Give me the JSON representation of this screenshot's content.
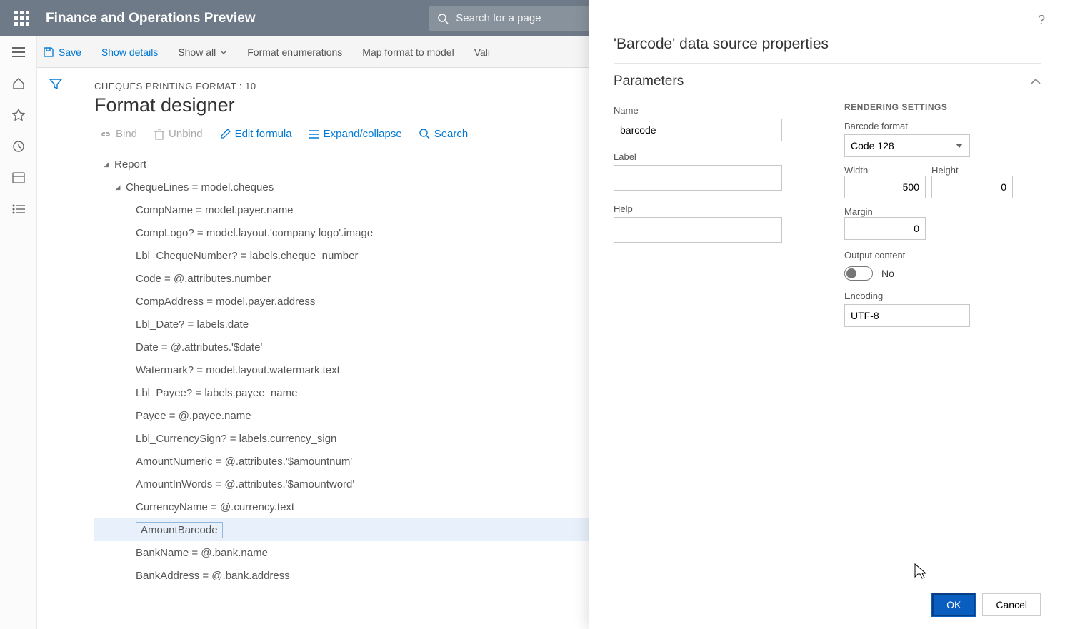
{
  "header": {
    "title": "Finance and Operations Preview",
    "search_placeholder": "Search for a page"
  },
  "toolbar": {
    "save": "Save",
    "show_details": "Show details",
    "show_all": "Show all",
    "format_enum": "Format enumerations",
    "map_format": "Map format to model",
    "validate": "Vali"
  },
  "page": {
    "crumb": "CHEQUES PRINTING FORMAT : 10",
    "title": "Format designer"
  },
  "actions": {
    "bind": "Bind",
    "unbind": "Unbind",
    "edit_formula": "Edit formula",
    "expand": "Expand/collapse",
    "search": "Search"
  },
  "tree": [
    {
      "indent": 0,
      "caret": true,
      "label": "Report"
    },
    {
      "indent": 1,
      "caret": true,
      "label": "ChequeLines = model.cheques"
    },
    {
      "indent": 2,
      "label": "CompName = model.payer.name"
    },
    {
      "indent": 2,
      "label": "CompLogo? = model.layout.'company logo'.image"
    },
    {
      "indent": 2,
      "label": "Lbl_ChequeNumber? = labels.cheque_number"
    },
    {
      "indent": 2,
      "label": "Code = @.attributes.number"
    },
    {
      "indent": 2,
      "label": "CompAddress = model.payer.address"
    },
    {
      "indent": 2,
      "label": "Lbl_Date? = labels.date"
    },
    {
      "indent": 2,
      "label": "Date = @.attributes.'$date'"
    },
    {
      "indent": 2,
      "label": "Watermark? = model.layout.watermark.text"
    },
    {
      "indent": 2,
      "label": "Lbl_Payee? = labels.payee_name"
    },
    {
      "indent": 2,
      "label": "Payee = @.payee.name"
    },
    {
      "indent": 2,
      "label": "Lbl_CurrencySign? = labels.currency_sign"
    },
    {
      "indent": 2,
      "label": "AmountNumeric = @.attributes.'$amountnum'"
    },
    {
      "indent": 2,
      "label": "AmountInWords = @.attributes.'$amountword'"
    },
    {
      "indent": 2,
      "label": "CurrencyName = @.currency.text"
    },
    {
      "indent": 2,
      "label": "AmountBarcode",
      "selected": true
    },
    {
      "indent": 2,
      "label": "BankName = @.bank.name"
    },
    {
      "indent": 2,
      "label": "BankAddress = @.bank.address"
    }
  ],
  "panel": {
    "title": "'Barcode' data source properties",
    "section": "Parameters",
    "left": {
      "name_label": "Name",
      "name_value": "barcode",
      "label_label": "Label",
      "label_value": "",
      "help_label": "Help",
      "help_value": ""
    },
    "right": {
      "header": "RENDERING SETTINGS",
      "format_label": "Barcode format",
      "format_value": "Code 128",
      "width_label": "Width",
      "width_value": "500",
      "height_label": "Height",
      "height_value": "0",
      "margin_label": "Margin",
      "margin_value": "0",
      "output_label": "Output content",
      "output_value": "No",
      "encoding_label": "Encoding",
      "encoding_value": "UTF-8"
    },
    "ok": "OK",
    "cancel": "Cancel"
  }
}
